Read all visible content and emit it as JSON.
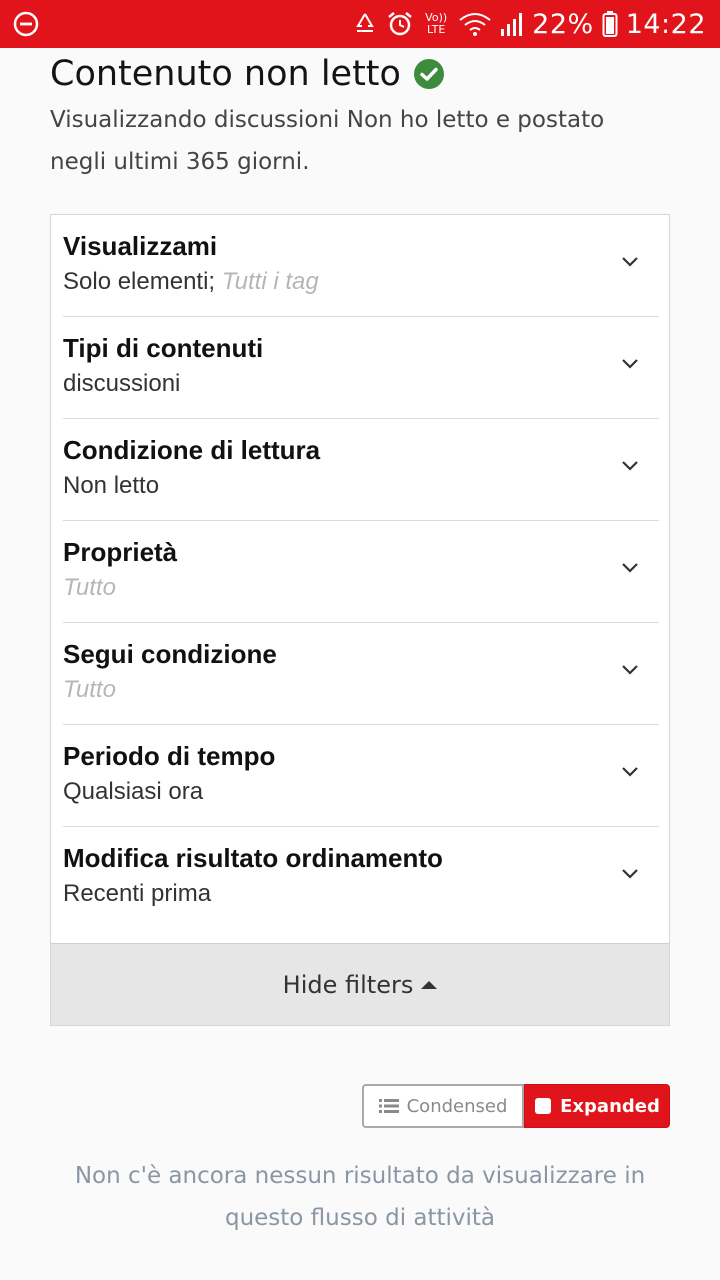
{
  "status_bar": {
    "battery_percent": "22%",
    "time": "14:22",
    "network_label": "Vo)) LTE",
    "icons": [
      "minus-circle-icon",
      "recycle-icon",
      "alarm-icon",
      "volte-icon",
      "wifi-icon",
      "signal-icon",
      "battery-icon"
    ],
    "background_color": "#e2141b"
  },
  "header": {
    "title": "Contenuto non letto",
    "title_icon": "check-circle-icon",
    "check_color": "#3d8b3d",
    "subtitle": "Visualizzando discussioni Non ho letto e postato negli ultimi 365 giorni."
  },
  "filters": {
    "items": [
      {
        "label": "Visualizzami",
        "value": "Solo elementi;",
        "value_extra": "Tutti i tag"
      },
      {
        "label": "Tipi di contenuti",
        "value": "discussioni",
        "value_extra": ""
      },
      {
        "label": "Condizione di lettura",
        "value": "Non letto",
        "value_extra": ""
      },
      {
        "label": "Proprietà",
        "value": "",
        "value_extra": "Tutto"
      },
      {
        "label": "Segui condizione",
        "value": "",
        "value_extra": "Tutto"
      },
      {
        "label": "Periodo di tempo",
        "value": "Qualsiasi ora",
        "value_extra": ""
      },
      {
        "label": "Modifica risultato ordinamento",
        "value": "Recenti prima",
        "value_extra": ""
      }
    ],
    "hide_label": "Hide filters"
  },
  "view_toggle": {
    "condensed_label": "Condensed",
    "expanded_label": "Expanded",
    "selected": "Expanded",
    "accent_color": "#e2141b"
  },
  "empty_message": "Non c'è ancora nessun risultato da visualizzare in questo flusso di attività"
}
